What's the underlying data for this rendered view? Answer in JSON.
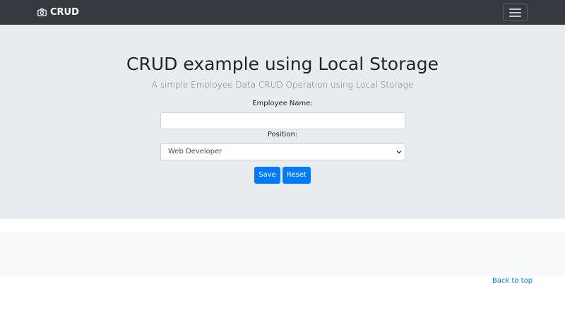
{
  "navbar": {
    "brand": "CRUD",
    "brand_icon": "camera-icon",
    "toggler_icon": "hamburger-menu-icon",
    "background": "#343a40"
  },
  "jumbotron": {
    "title": "CRUD example using Local Storage",
    "subtitle": "A simple Employee Data CRUD Operation using Local Storage",
    "background": "#e9ecef"
  },
  "form": {
    "name_label": "Employee Name:",
    "name_value": "",
    "position_label": "Position:",
    "position_value": "Web Developer",
    "save_label": "Save",
    "reset_label": "Reset"
  },
  "footer": {
    "back_to_top": "Back to top"
  },
  "colors": {
    "accent": "#007bff"
  }
}
